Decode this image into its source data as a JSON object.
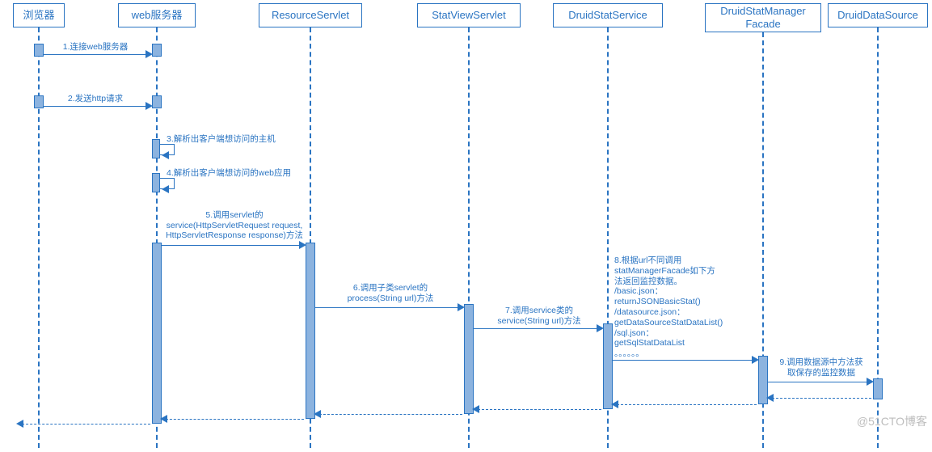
{
  "participants": {
    "p1": "浏览器",
    "p2": "web服务器",
    "p3": "ResourceServlet",
    "p4": "StatViewServlet",
    "p5": "DruidStatService",
    "p6": "DruidStatManager\nFacade",
    "p7": "DruidDataSource"
  },
  "messages": {
    "m1": "1.连接web服务器",
    "m2": "2.发送http请求",
    "m3": "3.解析出客户端想访问的主机",
    "m4": "4.解析出客户端想访问的web应用",
    "m5a": "5.调用servlet的",
    "m5b": "service(HttpServletRequest request,",
    "m5c": "HttpServletResponse response)方法",
    "m6a": "6.调用子类servlet的",
    "m6b": "process(String url)方法",
    "m7a": "7.调用service类的",
    "m7b": "service(String url)方法",
    "m8a": "8.根据url不同调用",
    "m8b": "statManagerFacade如下方",
    "m8c": "法返回监控数据。",
    "m8d": "/basic.json：",
    "m8e": "returnJSONBasicStat()",
    "m8f": "/datasource.json：",
    "m8g": "getDataSourceStatDataList()",
    "m8h": "/sql.json：",
    "m8i": "getSqlStatDataList",
    "m8j": "。。。。。。",
    "m9a": "9.调用数据源中方法获",
    "m9b": "取保存的监控数据"
  },
  "watermark": "@51CTO博客",
  "chart_data": {
    "type": "sequence-diagram",
    "participants": [
      "浏览器",
      "web服务器",
      "ResourceServlet",
      "StatViewServlet",
      "DruidStatService",
      "DruidStatManagerFacade",
      "DruidDataSource"
    ],
    "messages": [
      {
        "from": "浏览器",
        "to": "web服务器",
        "label": "1.连接web服务器",
        "kind": "sync"
      },
      {
        "from": "浏览器",
        "to": "web服务器",
        "label": "2.发送http请求",
        "kind": "sync"
      },
      {
        "from": "web服务器",
        "to": "web服务器",
        "label": "3.解析出客户端想访问的主机",
        "kind": "self"
      },
      {
        "from": "web服务器",
        "to": "web服务器",
        "label": "4.解析出客户端想访问的web应用",
        "kind": "self"
      },
      {
        "from": "web服务器",
        "to": "ResourceServlet",
        "label": "5.调用servlet的 service(HttpServletRequest request, HttpServletResponse response)方法",
        "kind": "sync"
      },
      {
        "from": "ResourceServlet",
        "to": "StatViewServlet",
        "label": "6.调用子类servlet的 process(String url)方法",
        "kind": "sync"
      },
      {
        "from": "StatViewServlet",
        "to": "DruidStatService",
        "label": "7.调用service类的 service(String url)方法",
        "kind": "sync"
      },
      {
        "from": "DruidStatService",
        "to": "DruidStatManagerFacade",
        "label": "8.根据url不同调用 statManagerFacade如下方法返回监控数据。 /basic.json：returnJSONBasicStat() /datasource.json：getDataSourceStatDataList() /sql.json：getSqlStatDataList 。。。。。。",
        "kind": "sync"
      },
      {
        "from": "DruidStatManagerFacade",
        "to": "DruidDataSource",
        "label": "9.调用数据源中方法获取保存的监控数据",
        "kind": "sync"
      },
      {
        "from": "DruidDataSource",
        "to": "DruidStatManagerFacade",
        "label": "",
        "kind": "return"
      },
      {
        "from": "DruidStatManagerFacade",
        "to": "DruidStatService",
        "label": "",
        "kind": "return"
      },
      {
        "from": "DruidStatService",
        "to": "StatViewServlet",
        "label": "",
        "kind": "return"
      },
      {
        "from": "StatViewServlet",
        "to": "ResourceServlet",
        "label": "",
        "kind": "return"
      },
      {
        "from": "ResourceServlet",
        "to": "web服务器",
        "label": "",
        "kind": "return"
      },
      {
        "from": "web服务器",
        "to": "浏览器",
        "label": "",
        "kind": "return"
      }
    ]
  }
}
